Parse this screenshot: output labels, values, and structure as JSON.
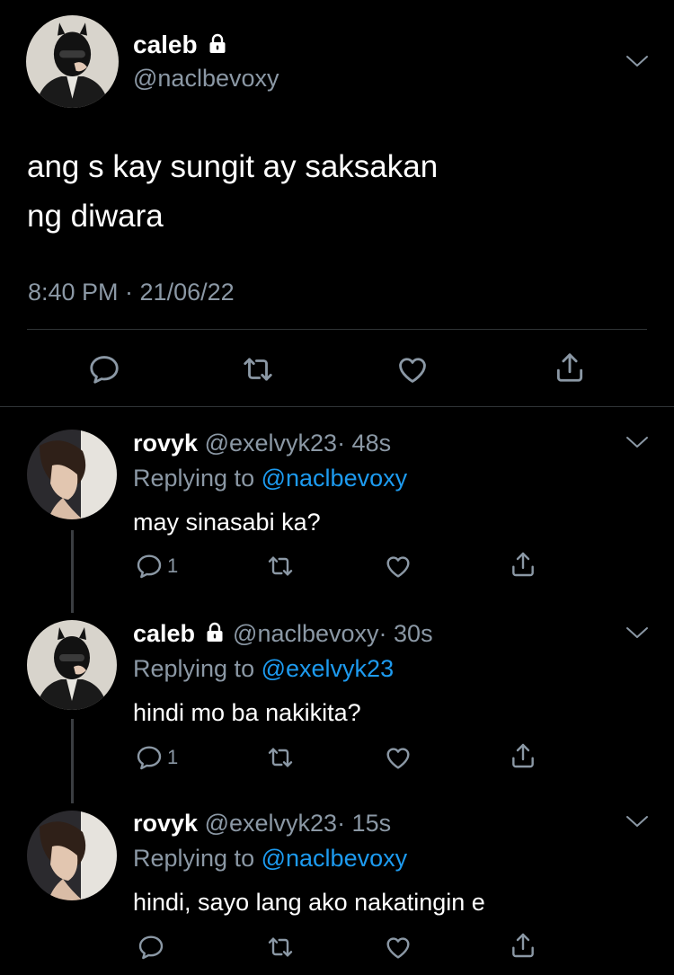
{
  "main_tweet": {
    "display_name": "caleb",
    "handle": "@naclbevoxy",
    "text_line1": "ang s kay sungit ay saksakan",
    "text_line2": "ng diwara",
    "timestamp": "8:40 PM · 21/06/22",
    "protected": true
  },
  "replies": [
    {
      "display_name": "rovyk",
      "handle": "@exelvyk23",
      "time": "· 48s",
      "replying_label": "Replying to",
      "replying_to": "@naclbevoxy",
      "text": "may sinasabi ka?",
      "reply_count": "1"
    },
    {
      "display_name": "caleb",
      "handle": "@naclbevoxy",
      "time": "· 30s",
      "replying_label": "Replying to",
      "replying_to": "@exelvyk23",
      "text": "hindi mo ba nakikita?",
      "reply_count": "1",
      "protected": true
    },
    {
      "display_name": "rovyk",
      "handle": "@exelvyk23",
      "time": "· 15s",
      "replying_label": "Replying to",
      "replying_to": "@naclbevoxy",
      "text": "hindi, sayo lang ako nakatingin e",
      "reply_count": ""
    }
  ],
  "icons": {
    "reply": "comment-icon",
    "retweet": "retweet-icon",
    "like": "heart-icon",
    "share": "share-icon",
    "more": "chevron-down-icon",
    "protected": "lock-icon"
  },
  "colors": {
    "background": "#000000",
    "text": "#ffffff",
    "secondary": "#8b98a5",
    "link": "#1d9bf0",
    "divider": "#2f3336"
  }
}
